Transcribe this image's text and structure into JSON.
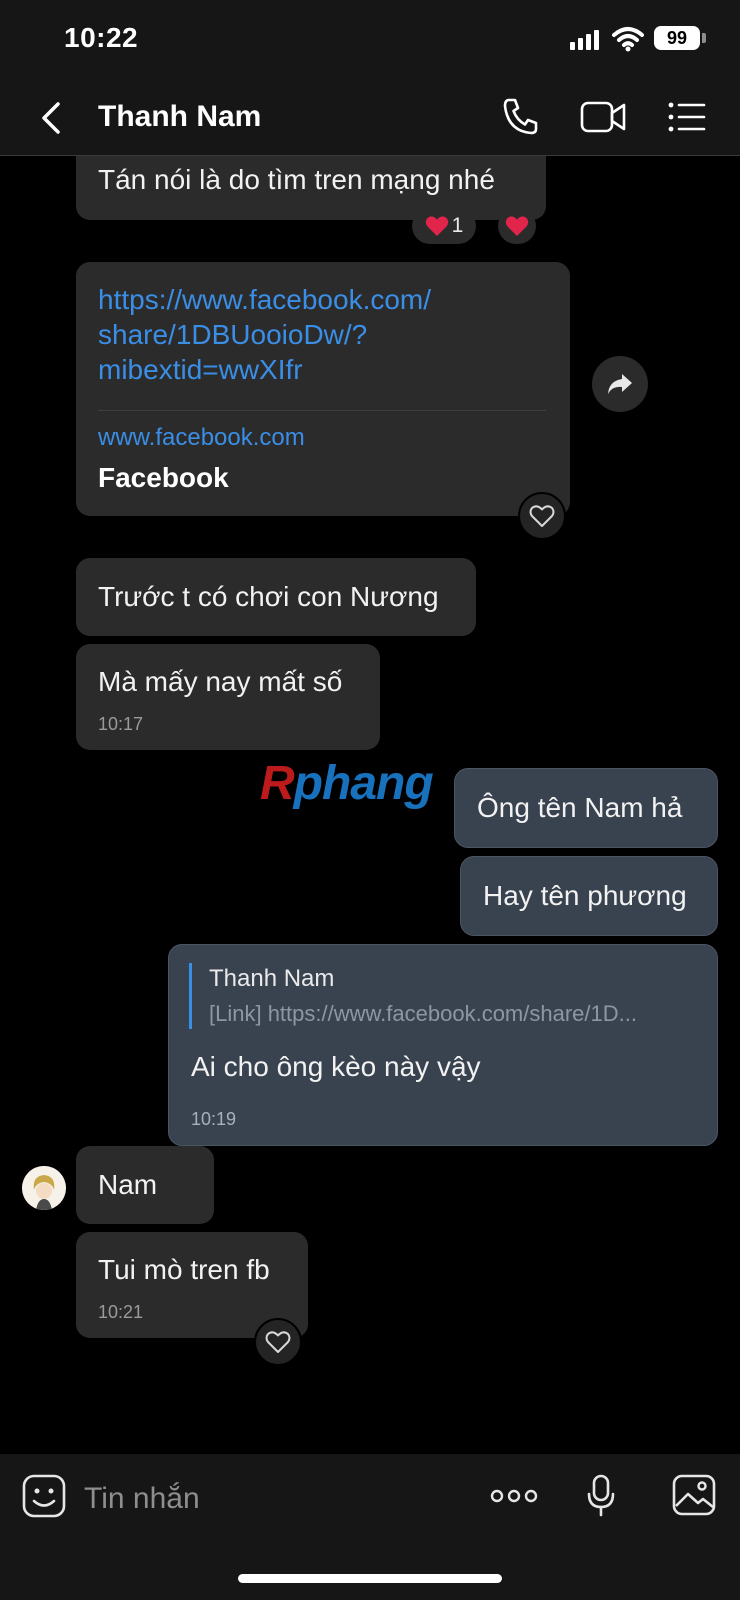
{
  "status_bar": {
    "time": "10:22",
    "battery": "99"
  },
  "header": {
    "title": "Thanh Nam"
  },
  "messages": {
    "m1": {
      "text": "Tán nói là do tìm tren mạng nhé",
      "reaction_count": "1"
    },
    "m2": {
      "link_line1": "https://www.facebook.com/",
      "link_line2": "share/1DBUooioDw/?",
      "link_line3": "mibextid=wwXIfr",
      "preview_domain": "www.facebook.com",
      "preview_title": "Facebook"
    },
    "m3": {
      "text": "Trước t có chơi con Nương"
    },
    "m4": {
      "text": "Mà mấy nay mất số",
      "time": "10:17"
    },
    "m5": {
      "text": "Ông tên Nam hả"
    },
    "m6": {
      "text": "Hay tên phương"
    },
    "m7": {
      "quote_name": "Thanh Nam",
      "quote_text": "[Link] https://www.facebook.com/share/1D...",
      "text": "Ai cho ông kèo này vậy",
      "time": "10:19"
    },
    "m8": {
      "text": "Nam"
    },
    "m9": {
      "text": "Tui mò tren fb",
      "time": "10:21"
    }
  },
  "watermark": {
    "first": "R",
    "rest": "phang"
  },
  "input": {
    "placeholder": "Tin nhắn"
  },
  "colors": {
    "link": "#3a8ee6",
    "received_bubble": "#2b2b2b",
    "sent_bubble": "#394350",
    "heart": "#e0244a"
  }
}
